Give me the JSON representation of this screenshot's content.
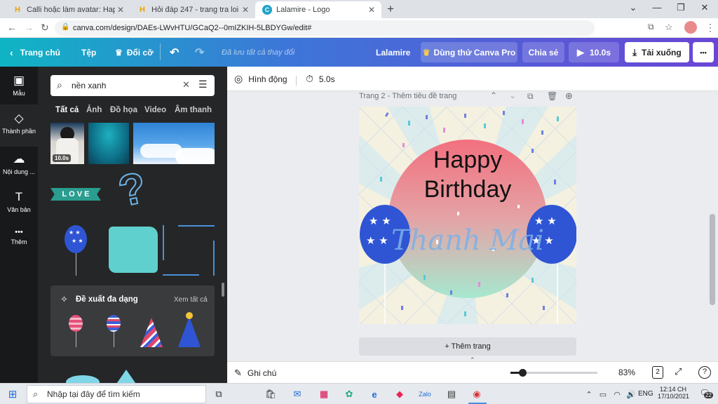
{
  "browser": {
    "tabs": [
      {
        "title": "Calli hoặc làm avatar: Happy Birth",
        "icon": "H"
      },
      {
        "title": "Hỏi đáp 247 - trang tra loi",
        "icon": "H"
      },
      {
        "title": "Lalamire - Logo",
        "icon": "C"
      }
    ],
    "new_tab": "+",
    "url": "canva.com/design/DAEs-LWvHTU/GCaQ2--0mIZKIH-5LBDYGw/edit#"
  },
  "header": {
    "home": "Trang chủ",
    "file": "Tệp",
    "resize": "Đổi cỡ",
    "saved": "Đã lưu tất cả thay đổi",
    "design_title": "Lalamire",
    "try_pro": "Dùng thử Canva Pro",
    "share": "Chia sẻ",
    "play_time": "10.0s",
    "download": "Tải xuống",
    "more": "•••"
  },
  "rail": [
    {
      "label": "Mẫu",
      "icon": "▣"
    },
    {
      "label": "Thành phần",
      "icon": "◇"
    },
    {
      "label": "Nội dung ...",
      "icon": "☁"
    },
    {
      "label": "Văn bản",
      "icon": "T"
    },
    {
      "label": "Thêm",
      "icon": "•••"
    }
  ],
  "panel": {
    "search_value": "nền xanh",
    "tabs": [
      "Tất cả",
      "Ảnh",
      "Đồ họa",
      "Video",
      "Âm thanh"
    ],
    "video_duration": "10.0s",
    "love_text": "L O V E",
    "suggest_title": "Đề xuất đa dạng",
    "suggest_see_all": "Xem tất cả"
  },
  "toolbar": {
    "animate": "Hình động",
    "duration": "5.0s"
  },
  "page": {
    "label": "Trang 2 - Thêm tiêu đề trang",
    "line1": "Happy",
    "line2": "Birthday",
    "name": "Thanh Mai",
    "add_page": "+ Thêm trang"
  },
  "bottom": {
    "notes": "Ghi chú",
    "zoom": "83%",
    "zoom_fraction": 0.5,
    "page_count": "2"
  },
  "taskbar": {
    "search_placeholder": "Nhập tại đây để tìm kiếm",
    "lang": "ENG",
    "time": "12:14 CH",
    "date": "17/10/2021",
    "notif": "22"
  },
  "colors": {
    "balloon": "#2f55d4",
    "title_text": "#111111",
    "name_text": "#7db0e8"
  }
}
